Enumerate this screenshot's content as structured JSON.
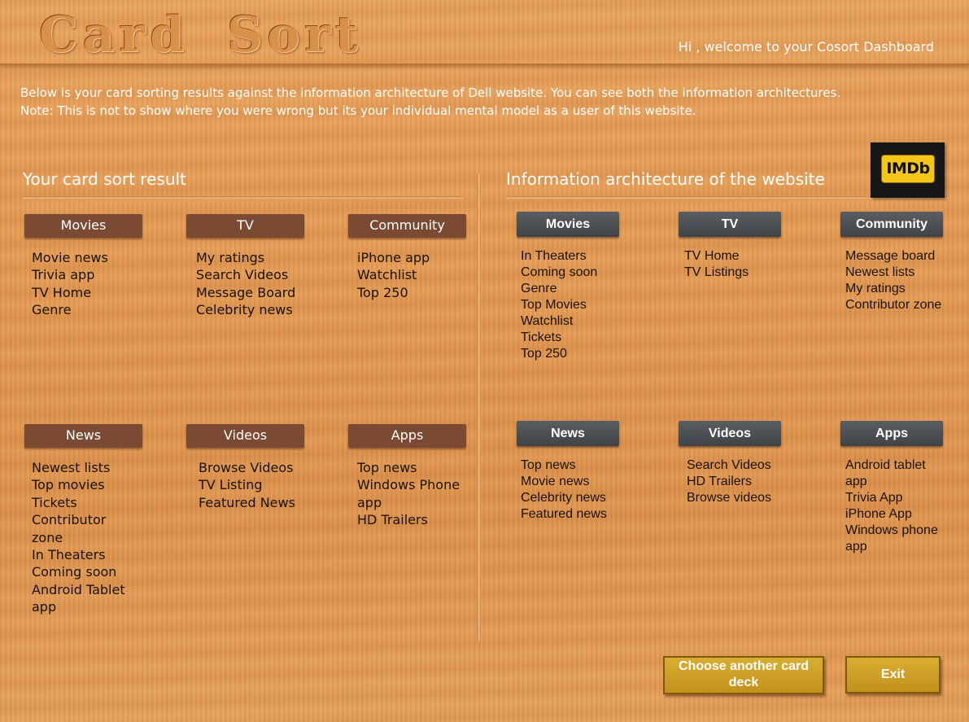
{
  "header": {
    "logo": "Card Sort",
    "welcome": "Hi , welcome to your Cosort Dashboard"
  },
  "intro": {
    "line1": "Below is your card sorting results against the information architecture of Dell website. You can see both the information architectures.",
    "line2": "Note: This is not to show where you were wrong but its your individual mental model as a user of this website."
  },
  "left_section": {
    "title": "Your card sort result",
    "groups": [
      {
        "label": "Movies",
        "items": [
          "Movie news",
          "Trivia app",
          "TV Home",
          "Genre"
        ]
      },
      {
        "label": "TV",
        "items": [
          "My ratings",
          "Search Videos",
          "Message Board",
          "Celebrity news"
        ]
      },
      {
        "label": "Community",
        "items": [
          "iPhone app",
          "Watchlist",
          "Top 250"
        ]
      },
      {
        "label": "News",
        "items": [
          "Newest lists",
          "Top movies",
          "Tickets",
          "Contributor zone",
          "In Theaters",
          "Coming soon",
          "Android Tablet app"
        ]
      },
      {
        "label": "Videos",
        "items": [
          "Browse Videos",
          "TV Listing",
          "Featured News"
        ]
      },
      {
        "label": "Apps",
        "items": [
          "Top news",
          "Windows Phone app",
          "HD Trailers"
        ]
      }
    ]
  },
  "right_section": {
    "title": "Information architecture of the website",
    "logo_text": "IMDb",
    "groups": [
      {
        "label": "Movies",
        "items": [
          "In Theaters",
          "Coming soon",
          "Genre",
          "Top Movies",
          "Watchlist",
          "Tickets",
          "Top 250"
        ]
      },
      {
        "label": "TV",
        "items": [
          "TV Home",
          "TV Listings"
        ]
      },
      {
        "label": "Community",
        "items": [
          "Message board",
          "Newest lists",
          "My ratings",
          "Contributor zone"
        ]
      },
      {
        "label": "News",
        "items": [
          "Top news",
          "Movie news",
          "Celebrity news",
          "Featured news"
        ]
      },
      {
        "label": "Videos",
        "items": [
          "Search Videos",
          "HD Trailers",
          "Browse videos"
        ]
      },
      {
        "label": "Apps",
        "items": [
          "Android tablet app",
          "Trivia App",
          "iPhone App",
          "Windows phone app"
        ]
      }
    ]
  },
  "buttons": {
    "choose_deck": "Choose another card deck",
    "exit": "Exit"
  }
}
